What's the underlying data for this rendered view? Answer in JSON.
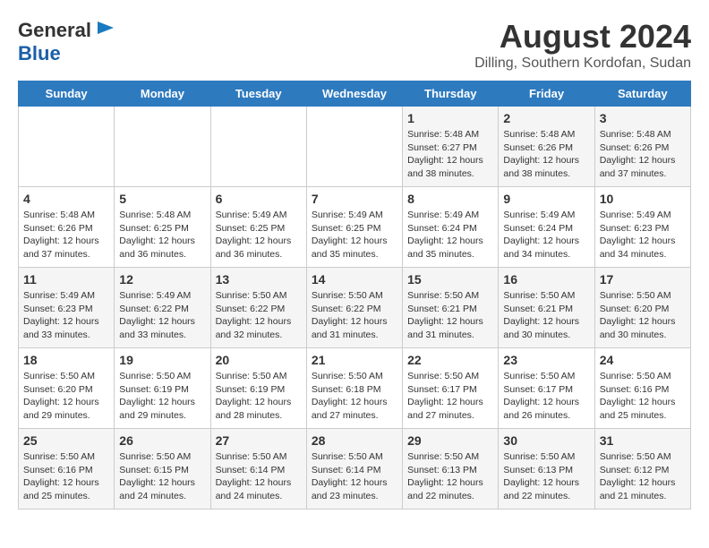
{
  "logo": {
    "line1": "General",
    "line2": "Blue"
  },
  "title": {
    "month_year": "August 2024",
    "location": "Dilling, Southern Kordofan, Sudan"
  },
  "days_of_week": [
    "Sunday",
    "Monday",
    "Tuesday",
    "Wednesday",
    "Thursday",
    "Friday",
    "Saturday"
  ],
  "weeks": [
    [
      {
        "day": "",
        "info": ""
      },
      {
        "day": "",
        "info": ""
      },
      {
        "day": "",
        "info": ""
      },
      {
        "day": "",
        "info": ""
      },
      {
        "day": "1",
        "info": "Sunrise: 5:48 AM\nSunset: 6:27 PM\nDaylight: 12 hours\nand 38 minutes."
      },
      {
        "day": "2",
        "info": "Sunrise: 5:48 AM\nSunset: 6:26 PM\nDaylight: 12 hours\nand 38 minutes."
      },
      {
        "day": "3",
        "info": "Sunrise: 5:48 AM\nSunset: 6:26 PM\nDaylight: 12 hours\nand 37 minutes."
      }
    ],
    [
      {
        "day": "4",
        "info": "Sunrise: 5:48 AM\nSunset: 6:26 PM\nDaylight: 12 hours\nand 37 minutes."
      },
      {
        "day": "5",
        "info": "Sunrise: 5:48 AM\nSunset: 6:25 PM\nDaylight: 12 hours\nand 36 minutes."
      },
      {
        "day": "6",
        "info": "Sunrise: 5:49 AM\nSunset: 6:25 PM\nDaylight: 12 hours\nand 36 minutes."
      },
      {
        "day": "7",
        "info": "Sunrise: 5:49 AM\nSunset: 6:25 PM\nDaylight: 12 hours\nand 35 minutes."
      },
      {
        "day": "8",
        "info": "Sunrise: 5:49 AM\nSunset: 6:24 PM\nDaylight: 12 hours\nand 35 minutes."
      },
      {
        "day": "9",
        "info": "Sunrise: 5:49 AM\nSunset: 6:24 PM\nDaylight: 12 hours\nand 34 minutes."
      },
      {
        "day": "10",
        "info": "Sunrise: 5:49 AM\nSunset: 6:23 PM\nDaylight: 12 hours\nand 34 minutes."
      }
    ],
    [
      {
        "day": "11",
        "info": "Sunrise: 5:49 AM\nSunset: 6:23 PM\nDaylight: 12 hours\nand 33 minutes."
      },
      {
        "day": "12",
        "info": "Sunrise: 5:49 AM\nSunset: 6:22 PM\nDaylight: 12 hours\nand 33 minutes."
      },
      {
        "day": "13",
        "info": "Sunrise: 5:50 AM\nSunset: 6:22 PM\nDaylight: 12 hours\nand 32 minutes."
      },
      {
        "day": "14",
        "info": "Sunrise: 5:50 AM\nSunset: 6:22 PM\nDaylight: 12 hours\nand 31 minutes."
      },
      {
        "day": "15",
        "info": "Sunrise: 5:50 AM\nSunset: 6:21 PM\nDaylight: 12 hours\nand 31 minutes."
      },
      {
        "day": "16",
        "info": "Sunrise: 5:50 AM\nSunset: 6:21 PM\nDaylight: 12 hours\nand 30 minutes."
      },
      {
        "day": "17",
        "info": "Sunrise: 5:50 AM\nSunset: 6:20 PM\nDaylight: 12 hours\nand 30 minutes."
      }
    ],
    [
      {
        "day": "18",
        "info": "Sunrise: 5:50 AM\nSunset: 6:20 PM\nDaylight: 12 hours\nand 29 minutes."
      },
      {
        "day": "19",
        "info": "Sunrise: 5:50 AM\nSunset: 6:19 PM\nDaylight: 12 hours\nand 29 minutes."
      },
      {
        "day": "20",
        "info": "Sunrise: 5:50 AM\nSunset: 6:19 PM\nDaylight: 12 hours\nand 28 minutes."
      },
      {
        "day": "21",
        "info": "Sunrise: 5:50 AM\nSunset: 6:18 PM\nDaylight: 12 hours\nand 27 minutes."
      },
      {
        "day": "22",
        "info": "Sunrise: 5:50 AM\nSunset: 6:17 PM\nDaylight: 12 hours\nand 27 minutes."
      },
      {
        "day": "23",
        "info": "Sunrise: 5:50 AM\nSunset: 6:17 PM\nDaylight: 12 hours\nand 26 minutes."
      },
      {
        "day": "24",
        "info": "Sunrise: 5:50 AM\nSunset: 6:16 PM\nDaylight: 12 hours\nand 25 minutes."
      }
    ],
    [
      {
        "day": "25",
        "info": "Sunrise: 5:50 AM\nSunset: 6:16 PM\nDaylight: 12 hours\nand 25 minutes."
      },
      {
        "day": "26",
        "info": "Sunrise: 5:50 AM\nSunset: 6:15 PM\nDaylight: 12 hours\nand 24 minutes."
      },
      {
        "day": "27",
        "info": "Sunrise: 5:50 AM\nSunset: 6:14 PM\nDaylight: 12 hours\nand 24 minutes."
      },
      {
        "day": "28",
        "info": "Sunrise: 5:50 AM\nSunset: 6:14 PM\nDaylight: 12 hours\nand 23 minutes."
      },
      {
        "day": "29",
        "info": "Sunrise: 5:50 AM\nSunset: 6:13 PM\nDaylight: 12 hours\nand 22 minutes."
      },
      {
        "day": "30",
        "info": "Sunrise: 5:50 AM\nSunset: 6:13 PM\nDaylight: 12 hours\nand 22 minutes."
      },
      {
        "day": "31",
        "info": "Sunrise: 5:50 AM\nSunset: 6:12 PM\nDaylight: 12 hours\nand 21 minutes."
      }
    ]
  ]
}
